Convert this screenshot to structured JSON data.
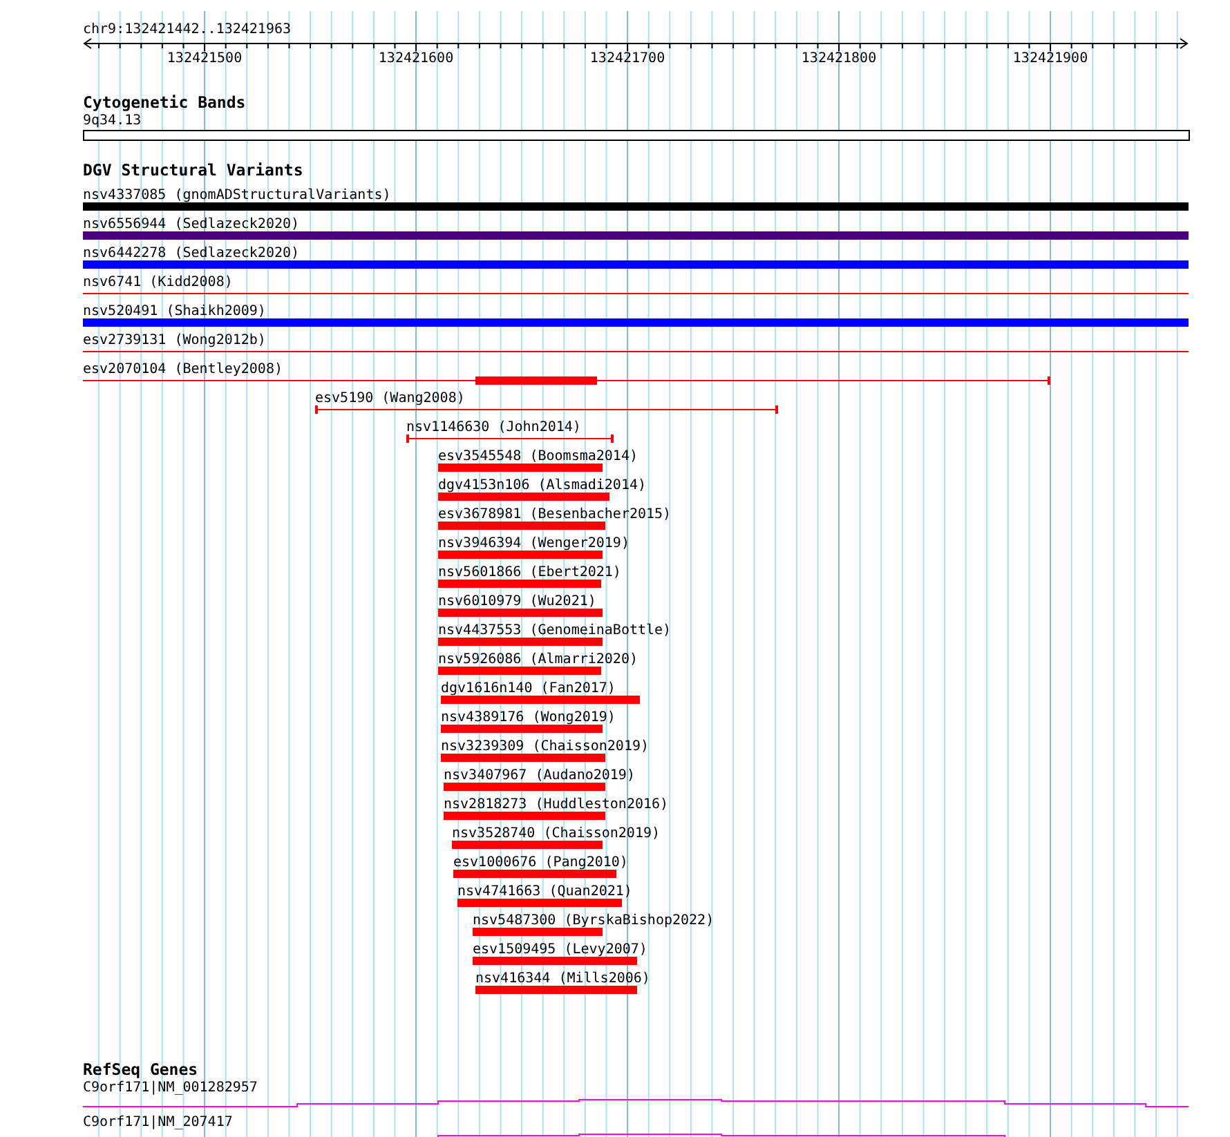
{
  "ruler": {
    "location": "chr9:132421442..132421963",
    "ticks": [
      "132421500",
      "132421600",
      "132421700",
      "132421800",
      "132421900"
    ]
  },
  "tracks": [
    {
      "kind": "cytoband",
      "title": "Cytogenetic Bands",
      "features": [
        {
          "label": "9q34.13"
        }
      ]
    },
    {
      "kind": "variants",
      "title": "DGV Structural Variants",
      "features": [
        {
          "label": "nsv4337085 (gnomADStructuralVariants)",
          "kind": "bar",
          "color": "#000000"
        },
        {
          "label": "nsv6556944 (Sedlazeck2020)",
          "kind": "bar",
          "color": "#4b0082"
        },
        {
          "label": "nsv6442278 (Sedlazeck2020)",
          "kind": "bar",
          "color": "#0000ff"
        },
        {
          "label": "nsv6741 (Kidd2008)",
          "kind": "line",
          "color": "#ff0000"
        },
        {
          "label": "nsv520491 (Shaikh2009)",
          "kind": "bar",
          "color": "#0000ff"
        },
        {
          "label": "esv2739131 (Wong2012b)",
          "kind": "line",
          "color": "#ff0000"
        },
        {
          "label": "esv2070104 (Bentley2008)",
          "kind": "span",
          "color": "#ff0000"
        },
        {
          "label": "esv5190 (Wang2008)",
          "kind": "span",
          "color": "#ff0000"
        },
        {
          "label": "nsv1146630 (John2014)",
          "kind": "span",
          "color": "#ff0000"
        },
        {
          "label": "esv3545548 (Boomsma2014)",
          "kind": "bar",
          "color": "#ff0000"
        },
        {
          "label": "dgv4153n106 (Alsmadi2014)",
          "kind": "bar",
          "color": "#ff0000"
        },
        {
          "label": "esv3678981 (Besenbacher2015)",
          "kind": "bar",
          "color": "#ff0000"
        },
        {
          "label": "nsv3946394 (Wenger2019)",
          "kind": "bar",
          "color": "#ff0000"
        },
        {
          "label": "nsv5601866 (Ebert2021)",
          "kind": "bar",
          "color": "#ff0000"
        },
        {
          "label": "nsv6010979 (Wu2021)",
          "kind": "bar",
          "color": "#ff0000"
        },
        {
          "label": "nsv4437553 (GenomeinaBottle)",
          "kind": "bar",
          "color": "#ff0000"
        },
        {
          "label": "nsv5926086 (Almarri2020)",
          "kind": "bar",
          "color": "#ff0000"
        },
        {
          "label": "dgv1616n140 (Fan2017)",
          "kind": "bar",
          "color": "#ff0000"
        },
        {
          "label": "nsv4389176 (Wong2019)",
          "kind": "bar",
          "color": "#ff0000"
        },
        {
          "label": "nsv3239309 (Chaisson2019)",
          "kind": "bar",
          "color": "#ff0000"
        },
        {
          "label": "nsv3407967 (Audano2019)",
          "kind": "bar",
          "color": "#ff0000"
        },
        {
          "label": "nsv2818273 (Huddleston2016)",
          "kind": "bar",
          "color": "#ff0000"
        },
        {
          "label": "nsv3528740 (Chaisson2019)",
          "kind": "bar",
          "color": "#ff0000"
        },
        {
          "label": "esv1000676 (Pang2010)",
          "kind": "bar",
          "color": "#ff0000"
        },
        {
          "label": "nsv4741663 (Quan2021)",
          "kind": "bar",
          "color": "#ff0000"
        },
        {
          "label": "nsv5487300 (ByrskaBishop2022)",
          "kind": "bar",
          "color": "#ff0000"
        },
        {
          "label": "esv1509495 (Levy2007)",
          "kind": "bar",
          "color": "#ff0000"
        },
        {
          "label": "nsv416344 (Mills2006)",
          "kind": "bar",
          "color": "#ff0000"
        }
      ]
    },
    {
      "kind": "genes",
      "title": "RefSeq Genes",
      "features": [
        {
          "label": "C9orf171|NM_001282957"
        },
        {
          "label": "C9orf171|NM_207417"
        }
      ]
    }
  ]
}
